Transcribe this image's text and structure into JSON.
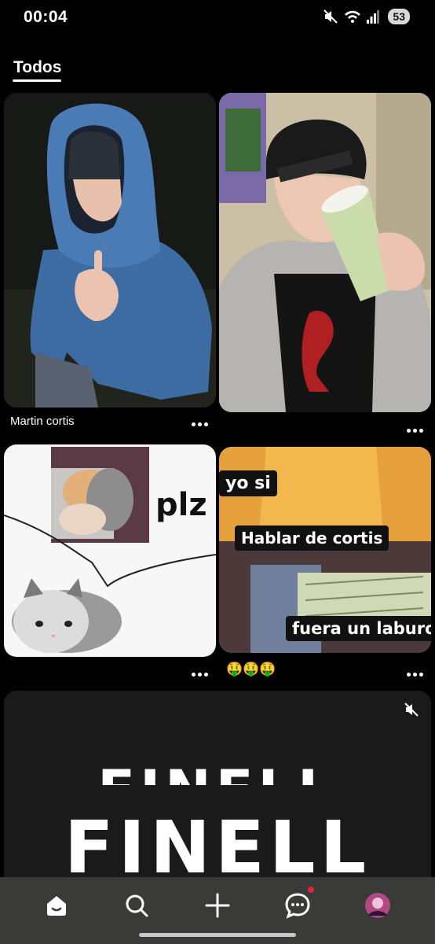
{
  "status_bar": {
    "time": "00:04",
    "battery": "53",
    "icons": [
      "mute-icon",
      "wifi-icon",
      "signal-icon",
      "battery-icon"
    ]
  },
  "tabs": [
    {
      "label": "Todos",
      "selected": true
    }
  ],
  "pins": [
    {
      "name": "pin-blue-hoodie",
      "caption": "Martin cortis"
    },
    {
      "name": "pin-beanie-drink",
      "caption": ""
    },
    {
      "name": "pin-kittens-plz",
      "caption": "",
      "meme_text": "plz"
    },
    {
      "name": "pin-money-meme",
      "caption": "🤑🤑🤑",
      "meme_lines": [
        "yo si",
        "Hablar de  cortis",
        "fuera un laburo"
      ]
    },
    {
      "name": "pin-video-finell",
      "caption": "",
      "title_text": "FINELL"
    }
  ],
  "bottom_nav": {
    "items": [
      "home-icon",
      "search-icon",
      "create-icon",
      "messages-icon",
      "profile-avatar"
    ],
    "active": "home-icon"
  },
  "colors": {
    "background": "#000000",
    "nav_background": "#3a3a38",
    "notification_dot": "#e0243a"
  }
}
